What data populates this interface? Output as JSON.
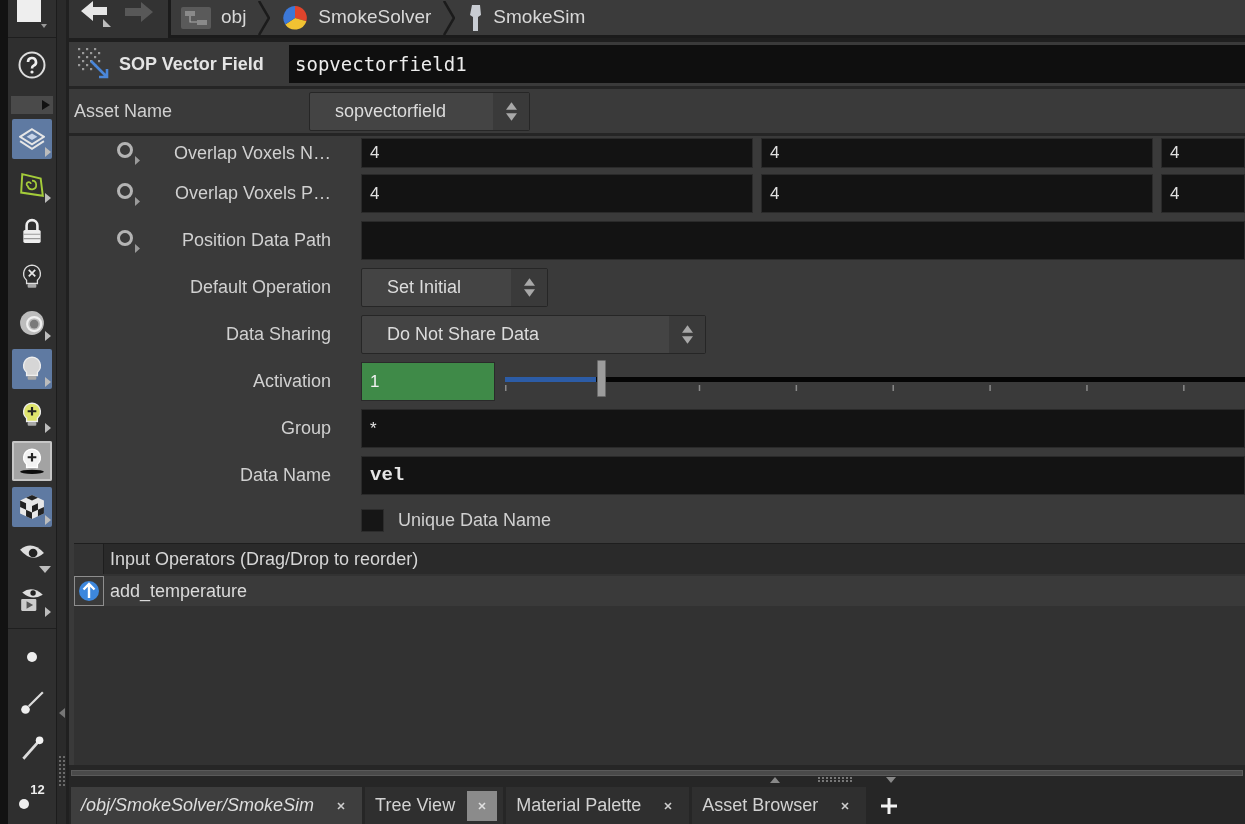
{
  "left_toolbar": {
    "items": [
      {
        "kind": "layers",
        "selected": true,
        "pressed": false,
        "menu_right": true,
        "menu_down": false
      },
      {
        "kind": "frame",
        "selected": false,
        "pressed": false,
        "menu_right": true,
        "menu_down": false
      },
      {
        "kind": "lock",
        "selected": false,
        "pressed": false,
        "menu_right": false,
        "menu_down": false
      },
      {
        "kind": "bulb-x",
        "selected": false,
        "pressed": false,
        "menu_right": false,
        "menu_down": false
      },
      {
        "kind": "sphere",
        "selected": false,
        "pressed": false,
        "menu_right": true,
        "menu_down": false
      },
      {
        "kind": "bulb",
        "selected": true,
        "pressed": false,
        "menu_right": true,
        "menu_down": false
      },
      {
        "kind": "bulb-plus",
        "selected": false,
        "pressed": false,
        "menu_right": true,
        "menu_down": false
      },
      {
        "kind": "bulb-plus-base",
        "selected": false,
        "pressed": true,
        "menu_right": false,
        "menu_down": false
      },
      {
        "kind": "cube",
        "selected": true,
        "pressed": false,
        "menu_right": true,
        "menu_down": false
      },
      {
        "kind": "eye",
        "selected": false,
        "pressed": false,
        "menu_right": false,
        "menu_down": true
      },
      {
        "kind": "camera-play",
        "selected": false,
        "pressed": false,
        "menu_right": true,
        "menu_down": false
      }
    ],
    "lower_items": [
      {
        "kind": "dot",
        "selected": false,
        "pressed": false,
        "menu_right": false,
        "menu_down": false
      },
      {
        "kind": "brush",
        "selected": false,
        "pressed": false,
        "menu_right": false,
        "menu_down": false
      },
      {
        "kind": "pin",
        "selected": false,
        "pressed": false,
        "menu_right": false,
        "menu_down": false
      },
      {
        "kind": "count",
        "label": "12",
        "selected": false,
        "pressed": false,
        "menu_right": false,
        "menu_down": false
      }
    ]
  },
  "nav": {
    "back_enabled": true,
    "forward_enabled": false
  },
  "breadcrumb": [
    {
      "kind": "network",
      "label": "obj"
    },
    {
      "kind": "solver",
      "label": "SmokeSolver"
    },
    {
      "kind": "object",
      "label": "SmokeSim"
    }
  ],
  "node": {
    "type_label": "SOP Vector Field",
    "name": "sopvectorfield1"
  },
  "asset": {
    "label": "Asset Name",
    "value": "sopvectorfield"
  },
  "parameters": [
    {
      "kind": "vector3",
      "label": "Overlap Voxels N…",
      "toggle": true,
      "values": [
        "4",
        "4",
        "4"
      ]
    },
    {
      "kind": "vector3",
      "label": "Overlap Voxels P…",
      "toggle": true,
      "values": [
        "4",
        "4",
        "4"
      ]
    },
    {
      "kind": "string",
      "label": "Position Data Path",
      "toggle": true,
      "bold": false
    },
    {
      "kind": "menu",
      "label": "Default Operation",
      "toggle": false,
      "value": "Set Initial"
    },
    {
      "kind": "menu",
      "label": "Data Sharing",
      "toggle": false,
      "value": "Do Not Share Data"
    },
    {
      "kind": "slider",
      "label": "Activation",
      "toggle": false,
      "value": "1",
      "highlighted": true,
      "level": 0.13
    },
    {
      "kind": "string",
      "label": "Group",
      "toggle": false,
      "value": "*",
      "bold": false
    },
    {
      "kind": "string",
      "label": "Data Name",
      "toggle": false,
      "value": "vel",
      "bold": true
    },
    {
      "kind": "checkbox",
      "label": "Unique Data Name",
      "toggle": false,
      "checked": false
    }
  ],
  "input_operators": {
    "header": "Input Operators (Drag/Drop to reorder)",
    "rows": [
      {
        "name": "add_temperature"
      }
    ]
  },
  "tabs": [
    {
      "kind": "path",
      "label": "/obj/SmokeSolver/SmokeSim",
      "selected": true,
      "close_hovered": false
    },
    {
      "kind": "pane",
      "label": "Tree View",
      "selected": false,
      "close_hovered": true
    },
    {
      "kind": "pane",
      "label": "Material Palette",
      "selected": false,
      "close_hovered": false
    },
    {
      "kind": "pane",
      "label": "Asset Browser",
      "selected": false,
      "close_hovered": false
    }
  ]
}
